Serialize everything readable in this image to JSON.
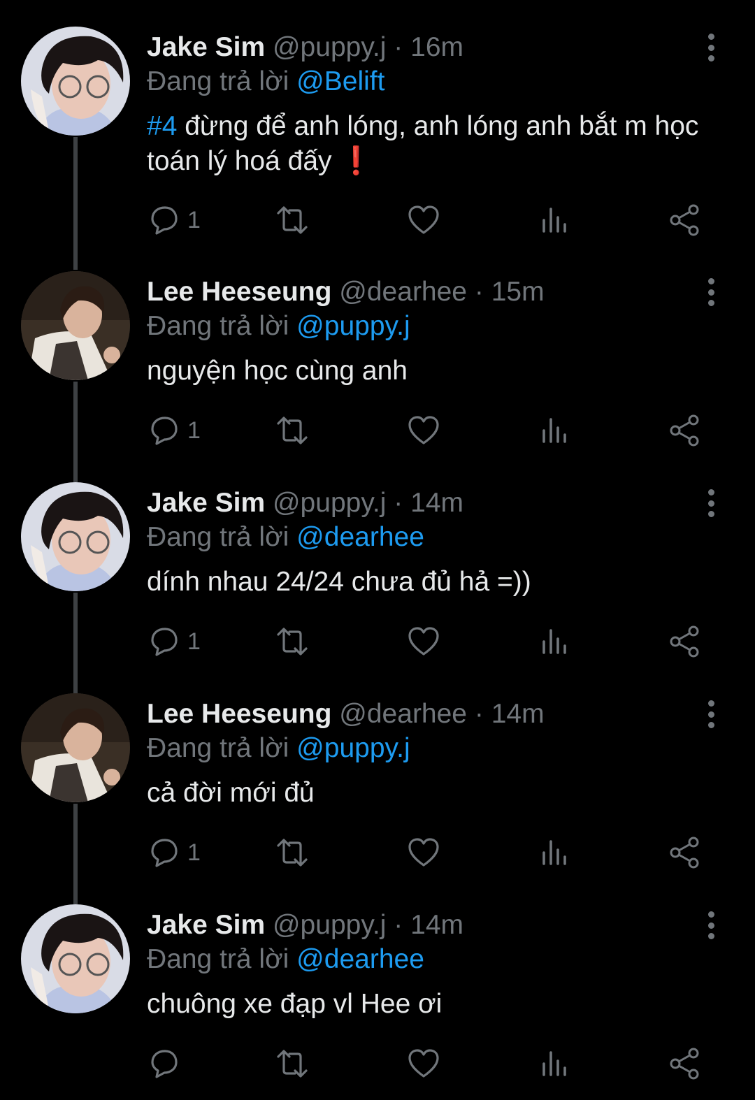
{
  "tweets": [
    {
      "name": "Jake Sim",
      "handle": "@puppy.j",
      "separator": "·",
      "time": "16m",
      "reply_prefix": "Đang trả lời",
      "reply_to": "@Belift",
      "hashtag": "#4",
      "text": " đừng để anh lóng, anh lóng anh bắt m học toán lý hoá đấy ❗",
      "reply_count": "1",
      "avatar": "jake-avatar"
    },
    {
      "name": "Lee Heeseung",
      "handle": "@dearhee",
      "separator": "·",
      "time": "15m",
      "reply_prefix": "Đang trả lời",
      "reply_to": "@puppy.j",
      "hashtag": "",
      "text": "nguyện học cùng anh",
      "reply_count": "1",
      "avatar": "heeseung-avatar"
    },
    {
      "name": "Jake Sim",
      "handle": "@puppy.j",
      "separator": "·",
      "time": "14m",
      "reply_prefix": "Đang trả lời",
      "reply_to": "@dearhee",
      "hashtag": "",
      "text": "dính nhau 24/24 chưa đủ hả =))",
      "reply_count": "1",
      "avatar": "jake-avatar"
    },
    {
      "name": "Lee Heeseung",
      "handle": "@dearhee",
      "separator": "·",
      "time": "14m",
      "reply_prefix": "Đang trả lời",
      "reply_to": "@puppy.j",
      "hashtag": "",
      "text": "cả đời mới đủ",
      "reply_count": "1",
      "avatar": "heeseung-avatar"
    },
    {
      "name": "Jake Sim",
      "handle": "@puppy.j",
      "separator": "·",
      "time": "14m",
      "reply_prefix": "Đang trả lời",
      "reply_to": "@dearhee",
      "hashtag": "",
      "text": "chuông xe đạp vl Hee ơi",
      "reply_count": "",
      "avatar": "jake-avatar"
    }
  ],
  "icons": {
    "reply": "comment-bubble-icon",
    "retweet": "retweet-icon",
    "like": "heart-icon",
    "views": "bar-chart-icon",
    "share": "share-icon",
    "more": "more-vertical-icon"
  },
  "colors": {
    "background": "#000000",
    "text": "#e7e9ea",
    "secondary": "#71767b",
    "link": "#1d9bf0",
    "thread_line": "#3e4144"
  }
}
